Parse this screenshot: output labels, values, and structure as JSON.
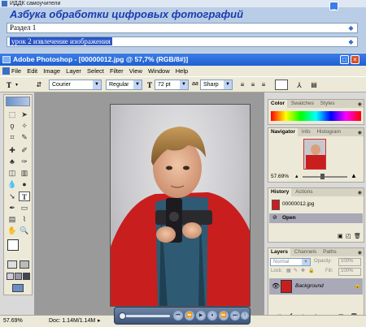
{
  "outer_window": {
    "title": "ИДДК самоучители"
  },
  "tutorial": {
    "title": "Азбука обработки цифровых фотографий",
    "section_select": "Раздел 1",
    "lesson_select": "урок 2 извлечение изображения"
  },
  "photoshop": {
    "title": "Adobe Photoshop - [00000012.jpg @ 57,7% (RGB/8#)]",
    "menu": [
      "File",
      "Edit",
      "Image",
      "Layer",
      "Select",
      "Filter",
      "View",
      "Window",
      "Help"
    ],
    "options": {
      "font_family": "Courier",
      "font_style": "Regular",
      "font_size": "72 pt",
      "aa_label": "aa",
      "antialias": "Sharp"
    },
    "color_panel": {
      "tabs": [
        "Color",
        "Swatches",
        "Styles"
      ]
    },
    "navigator": {
      "tabs": [
        "Navigator",
        "Info",
        "Histogram"
      ],
      "zoom": "57.69%"
    },
    "history": {
      "tabs": [
        "History",
        "Actions"
      ],
      "snapshot": "00000012.jpg",
      "item": "Open"
    },
    "layers": {
      "tabs": [
        "Layers",
        "Channels",
        "Paths"
      ],
      "blend_mode": "Normal",
      "opacity_label": "Opacity:",
      "opacity": "100%",
      "lock_label": "Lock:",
      "fill_label": "Fill:",
      "fill": "100%",
      "layer_name": "Background"
    },
    "status": {
      "zoom": "57.69%",
      "doc": "Doc: 1.14M/1.14M"
    }
  },
  "colors": {
    "ps_title": "#245edb",
    "tutorial_bg": "#b9cde6",
    "tutorial_title": "#1a3cb0",
    "selection": "#2a55c8"
  }
}
